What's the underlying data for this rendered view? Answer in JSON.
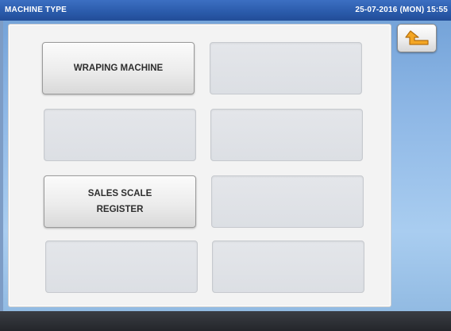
{
  "header": {
    "title": "MACHINE TYPE",
    "datetime": "25-07-2016 (MON) 15:55"
  },
  "buttons": [
    {
      "label": "WRAPING MACHINE",
      "enabled": true
    },
    {
      "label": "",
      "enabled": false
    },
    {
      "label": "",
      "enabled": false
    },
    {
      "label": "",
      "enabled": false
    },
    {
      "label": "SALES SCALE\nREGISTER",
      "enabled": true
    },
    {
      "label": "",
      "enabled": false
    },
    {
      "label": "",
      "enabled": false
    },
    {
      "label": "",
      "enabled": false
    }
  ],
  "back_button": {
    "icon": "return-arrow-icon",
    "color": "#f0a020"
  },
  "colors": {
    "title_bar": "#2a5aaa",
    "panel": "#f3f3f3",
    "background": "#8fb8e6"
  }
}
